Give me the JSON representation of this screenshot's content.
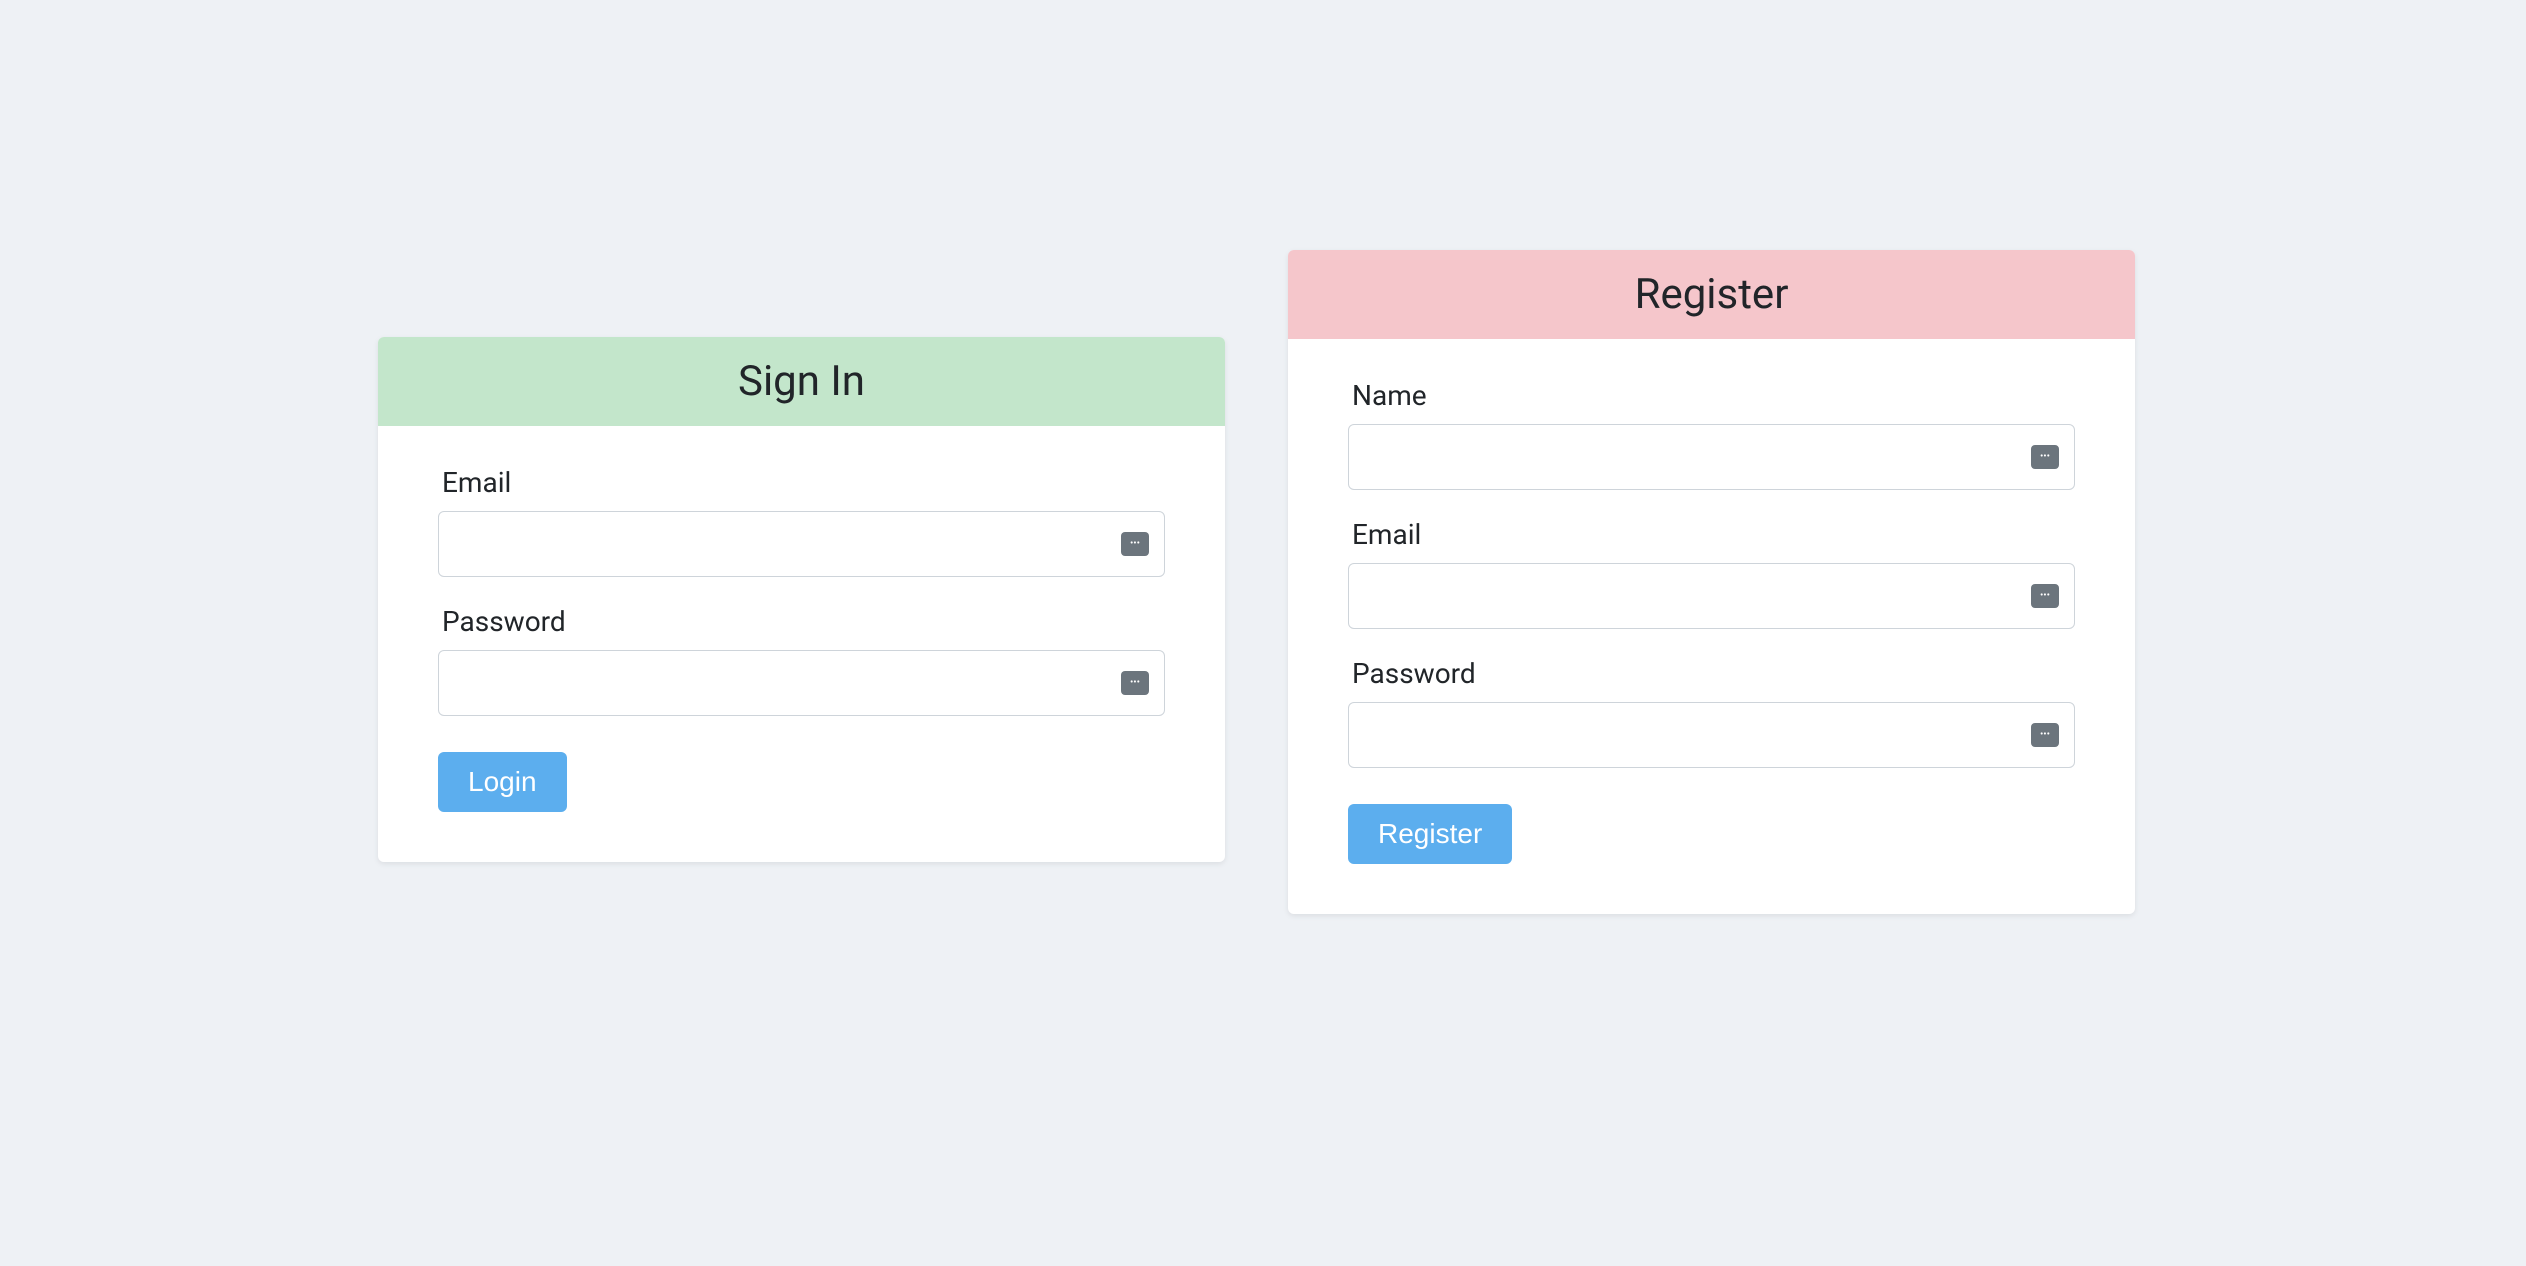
{
  "signin": {
    "title": "Sign In",
    "email_label": "Email",
    "email_value": "",
    "password_label": "Password",
    "password_value": "",
    "button_label": "Login"
  },
  "register": {
    "title": "Register",
    "name_label": "Name",
    "name_value": "",
    "email_label": "Email",
    "email_value": "",
    "password_label": "Password",
    "password_value": "",
    "button_label": "Register"
  }
}
